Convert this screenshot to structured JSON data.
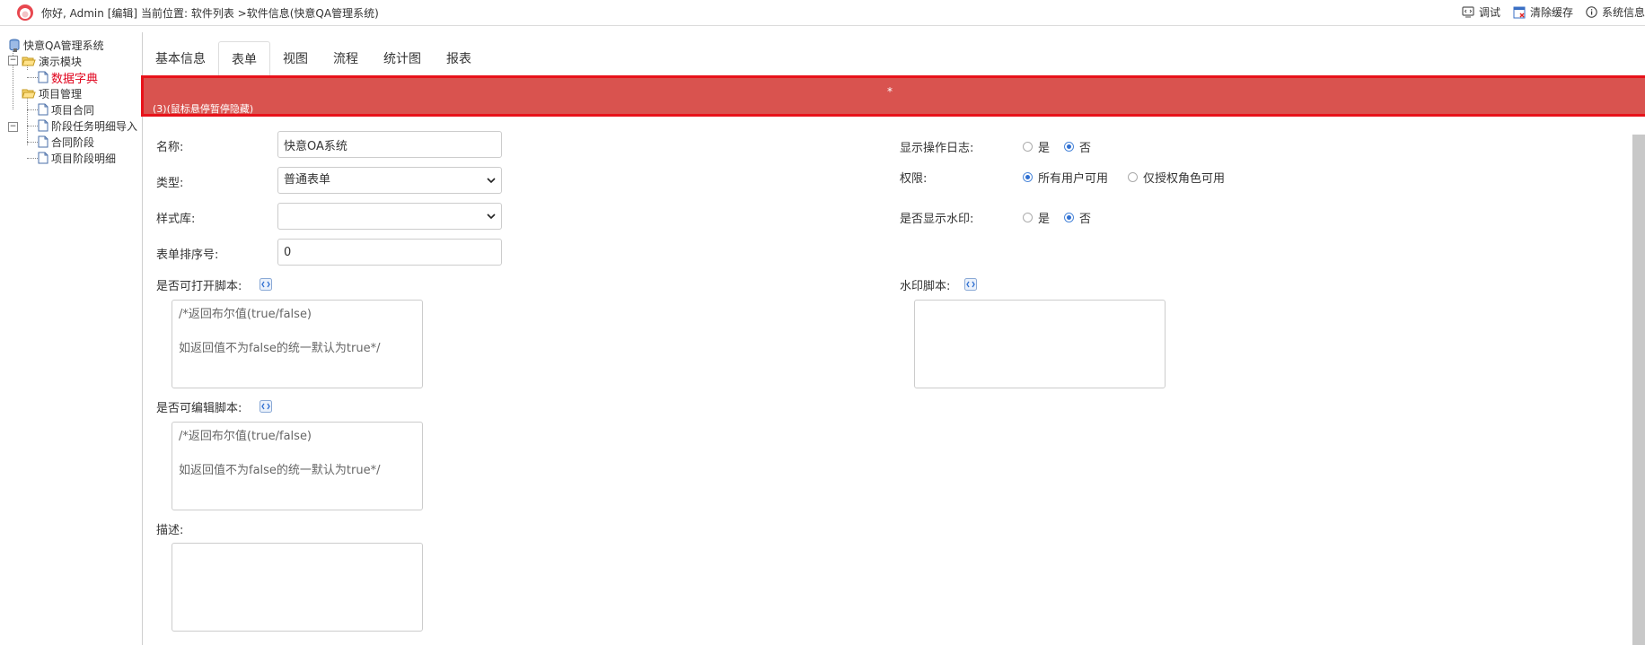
{
  "header": {
    "greeting": "你好, Admin [编辑]",
    "breadcrumb": "当前位置: 软件列表 >软件信息(快意QA管理系统)",
    "tools": [
      {
        "label": "调试",
        "icon": "debug-icon"
      },
      {
        "label": "清除缓存",
        "icon": "clear-cache-icon"
      },
      {
        "label": "系统信息",
        "icon": "info-icon"
      }
    ]
  },
  "tree": {
    "root": "快意QA管理系统",
    "groups": [
      {
        "label": "演示模块",
        "items": [
          "数据字典"
        ]
      },
      {
        "label": "项目管理",
        "items": [
          "项目合同",
          "阶段任务明细导入",
          "合同阶段",
          "项目阶段明细"
        ]
      }
    ]
  },
  "tabs": [
    "基本信息",
    "表单",
    "视图",
    "流程",
    "统计图",
    "报表"
  ],
  "active_tab": "表单",
  "banner": {
    "star": "*",
    "message": "(3)(鼠标悬停暂停隐藏)",
    "color": "#d9534f"
  },
  "form": {
    "name_label": "名称:",
    "name_value": "快意OA系统",
    "type_label": "类型:",
    "type_value": "普通表单",
    "style_label": "样式库:",
    "style_value": "",
    "order_label": "表单排序号:",
    "order_value": "0",
    "open_script_label": "是否可打开脚本:",
    "open_script_line1": "/*返回布尔值(true/false)",
    "open_script_line2": "如返回值不为false的统一默认为true*/",
    "edit_script_label": "是否可编辑脚本:",
    "edit_script_line1": "/*返回布尔值(true/false)",
    "edit_script_line2": "如返回值不为false的统一默认为true*/",
    "desc_label": "描述:",
    "show_log_label": "显示操作日志:",
    "show_log_options": [
      "是",
      "否"
    ],
    "show_log_selected": "否",
    "permission_label": "权限:",
    "permission_options": [
      "所有用户可用",
      "仅授权角色可用"
    ],
    "permission_selected": "所有用户可用",
    "watermark_label": "是否显示水印:",
    "watermark_options": [
      "是",
      "否"
    ],
    "watermark_selected": "否",
    "watermark_script_label": "水印脚本:"
  }
}
